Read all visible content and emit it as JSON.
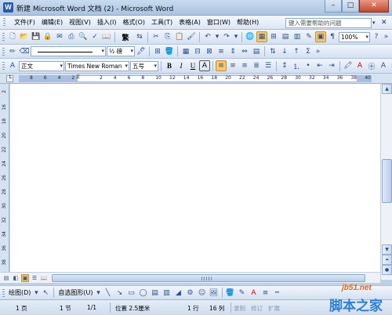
{
  "window": {
    "title": "新建 Microsoft Word 文档 (2) - Microsoft Word",
    "app_icon": "W"
  },
  "window_buttons": {
    "minimize": "–",
    "maximize": "□",
    "close": "✕"
  },
  "menubar": {
    "items": [
      "文件(F)",
      "编辑(E)",
      "视图(V)",
      "插入(I)",
      "格式(O)",
      "工具(T)",
      "表格(A)",
      "窗口(W)",
      "帮助(H)"
    ],
    "help_placeholder": "键入需要帮助的问题",
    "close_doc": "✕"
  },
  "standard_toolbar": {
    "zoom": "100%",
    "traditional_label": "繁"
  },
  "tables_toolbar": {
    "line_weight": "½ 磅"
  },
  "formatting_toolbar": {
    "style": "正文",
    "font": "Times New Roman",
    "size": "五号",
    "bold": "B",
    "italic": "I",
    "underline": "U",
    "char_border": "A"
  },
  "ruler": {
    "numbers": [
      "8",
      "6",
      "4",
      "2",
      "",
      "2",
      "4",
      "6",
      "8",
      "10",
      "12",
      "14",
      "16",
      "18",
      "20",
      "22",
      "24",
      "26",
      "28",
      "30",
      "32",
      "34",
      "36",
      "38",
      "40"
    ]
  },
  "vertical_ruler": {
    "numbers": [
      "2",
      "16",
      "18",
      "20",
      "22",
      "24",
      "26",
      "28",
      "30",
      "32",
      "34",
      "36",
      "38"
    ]
  },
  "drawing_toolbar": {
    "draw_label": "绘图(D)",
    "autoshapes_label": "自选图形(U)"
  },
  "statusbar": {
    "page": "1 页",
    "section": "1 节",
    "page_of": "1/1",
    "position": "位置 2.5厘米",
    "line": "1 行",
    "column": "16 列",
    "rec": "录制",
    "trk": "修订",
    "ext": "扩展"
  },
  "watermark": {
    "site": "jb51.net",
    "name": "脚本之家"
  },
  "colors": {
    "accent": "#f7c86a",
    "chrome": "#d3e0f1",
    "status": "#cfdcee"
  }
}
